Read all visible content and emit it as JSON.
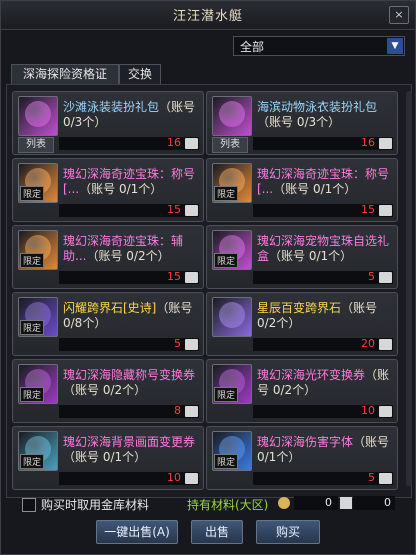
{
  "window": {
    "title": "汪汪潜水艇",
    "close_label": "×"
  },
  "filter": {
    "selected": "全部"
  },
  "tabs": [
    {
      "label": "深海探险资格证"
    },
    {
      "label": "交换"
    }
  ],
  "items": [
    {
      "name_parts": [
        {
          "text": "沙滩泳装装扮礼包",
          "color": "#9bd6ff"
        }
      ],
      "account": "（账号 0/3个）",
      "qty": "16",
      "icon_color": "#c050d0",
      "limited": false,
      "list_label": "列表"
    },
    {
      "name_parts": [
        {
          "text": "海滨动物泳衣装扮礼包",
          "color": "#9bd6ff"
        }
      ],
      "account": "（账号 0/3个）",
      "qty": "16",
      "icon_color": "#c050d0",
      "limited": false,
      "list_label": "列表"
    },
    {
      "name_parts": [
        {
          "text": "瑰幻深海奇迹宝珠：称号[...",
          "color": "#ff7ae0"
        }
      ],
      "account": "（账号 0/1个）",
      "qty": "15",
      "icon_color": "#e08a3a",
      "limited": true,
      "limit_label": "限定"
    },
    {
      "name_parts": [
        {
          "text": "瑰幻深海奇迹宝珠：称号[...",
          "color": "#ff7ae0"
        }
      ],
      "account": "（账号 0/1个）",
      "qty": "15",
      "icon_color": "#e08a3a",
      "limited": true,
      "limit_label": "限定"
    },
    {
      "name_parts": [
        {
          "text": "瑰幻深海奇迹宝珠：辅助...",
          "color": "#ff7ae0"
        }
      ],
      "account": "（账号 0/2个）",
      "qty": "15",
      "icon_color": "#e08a3a",
      "limited": true,
      "limit_label": "限定"
    },
    {
      "name_parts": [
        {
          "text": "瑰幻深海宠物宝珠自选礼盒",
          "color": "#ff7ae0"
        }
      ],
      "account": "（账号 0/1个）",
      "qty": "5",
      "icon_color": "#c050d0",
      "limited": true,
      "limit_label": "限定"
    },
    {
      "name_parts": [
        {
          "text": "闪耀跨界石[史诗]",
          "color": "#ffd54a"
        }
      ],
      "account": "（账号 0/8个）",
      "qty": "5",
      "icon_color": "#6b4cc7",
      "limited": true,
      "limit_label": "限定"
    },
    {
      "name_parts": [
        {
          "text": "星辰百变跨界石",
          "color": "#ffd54a"
        }
      ],
      "account": "（账号 0/2个）",
      "qty": "20",
      "icon_color": "#8a6bdc",
      "limited": false
    },
    {
      "name_parts": [
        {
          "text": "瑰幻深海隐藏称号变换券",
          "color": "#ff7ae0"
        }
      ],
      "account": "（账号 0/2个）",
      "qty": "8",
      "icon_color": "#9b3cc0",
      "limited": true,
      "limit_label": "限定"
    },
    {
      "name_parts": [
        {
          "text": "瑰幻深海光环变换券",
          "color": "#ff7ae0"
        }
      ],
      "account": "（账号 0/2个）",
      "qty": "10",
      "icon_color": "#9b3cc0",
      "limited": true,
      "limit_label": "限定"
    },
    {
      "name_parts": [
        {
          "text": "瑰幻深海背景画面变更券",
          "color": "#ff7ae0"
        }
      ],
      "account": "（账号 0/1个）",
      "qty": "10",
      "icon_color": "#4aa0c0",
      "limited": true,
      "limit_label": "限定"
    },
    {
      "name_parts": [
        {
          "text": "瑰幻深海伤害字体",
          "color": "#ff7ae0"
        }
      ],
      "account": "（账号 0/1个）",
      "qty": "5",
      "icon_color": "#3a7be0",
      "limited": true,
      "limit_label": "限定"
    }
  ],
  "footer": {
    "checkbox_label": "购买时取用金库材料",
    "hold_label": "持有材料(大区)",
    "hold_value_1": "0",
    "hold_value_2": "0",
    "buttons": {
      "sell_all": "一键出售(A)",
      "sell": "出售",
      "buy": "购买"
    }
  }
}
